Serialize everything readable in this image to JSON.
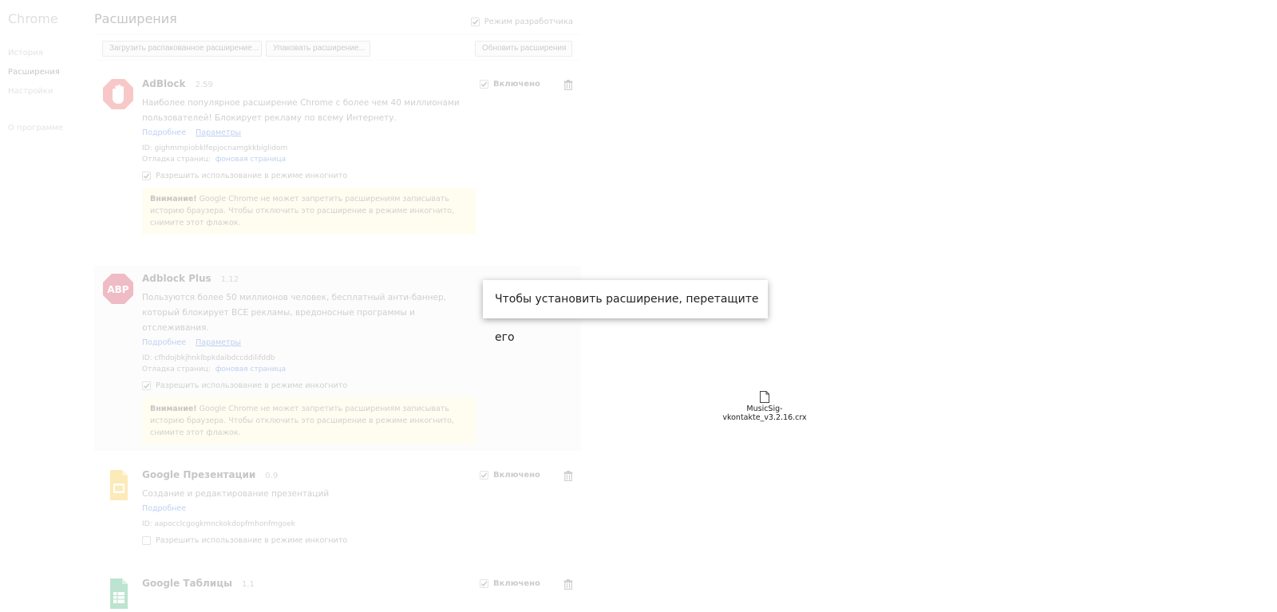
{
  "sidebar": {
    "brand": "Chrome",
    "items": [
      {
        "label": "История"
      },
      {
        "label": "Расширения"
      },
      {
        "label": "Настройки"
      },
      {
        "label": "О программе"
      }
    ],
    "selected": "Расширения"
  },
  "header": {
    "title": "Расширения",
    "dev_mode_label": "Режим разработчика",
    "dev_mode_checked": true
  },
  "toolbar": {
    "load_unpacked": "Загрузить распакованное расширение...",
    "pack": "Упаковать расширение...",
    "update": "Обновить расширения"
  },
  "common": {
    "enabled_label": "Включено",
    "details_label": "Подробнее",
    "options_label": "Параметры",
    "id_prefix": "ID:",
    "inspect_label": "Отладка страниц:",
    "background_page": "фоновая страница",
    "incognito_label": "Разрешить использование в режиме инкогнито",
    "warning_bold": "Внимание!",
    "warning_text": " Google Chrome не может запретить расширениям записывать историю браузера. Чтобы отключить это расширение в режиме инкогнито, снимите этот флажок."
  },
  "extensions": [
    {
      "name": "AdBlock",
      "version": "2.59",
      "description": "Наиболее популярное расширение Chrome с более чем 40 миллионами пользователей! Блокирует рекламу по всему Интернету.",
      "id": "gighmmpiobklfepjocnamgkkbiglidom",
      "icon": "adblock-hand-icon",
      "color": "#e63a3a"
    },
    {
      "name": "Adblock Plus",
      "version": "1.12",
      "description": "Пользуются более 50 миллионов человек, бесплатный анти-баннер, который блокирует ВСЕ рекламы, вредоносные программы и отслеживания.",
      "id": "cfhdojbkjhnklbpkdaibdccddilifddb",
      "icon": "abp-octagon-icon",
      "icon_text": "ABP",
      "color": "#c70d2c"
    },
    {
      "name": "Google Презентации",
      "version": "0.9",
      "description": "Создание и редактирование презентаций",
      "id": "aapocclcgogkmnckokdopfmhonfmgoek",
      "icon": "slides-icon",
      "color": "#f4b400"
    },
    {
      "name": "Google Таблицы",
      "version": "1.1",
      "icon": "sheets-icon",
      "color": "#0f9d58"
    }
  ],
  "overlay": {
    "tooltip": "Чтобы установить расширение, перетащите его",
    "file_name": "MusicSig-vkontakte_v3.2.16.crx"
  }
}
